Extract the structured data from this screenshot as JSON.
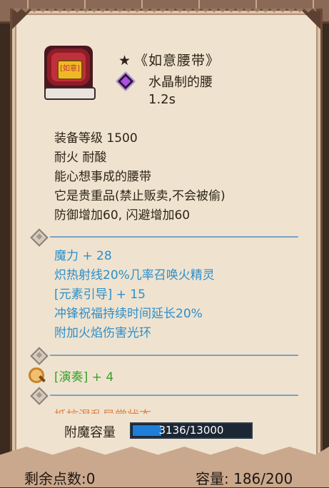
{
  "item": {
    "star": "★",
    "name": "《如意腰带》",
    "subtype": "水晶制的腰",
    "speed": "1.2s",
    "buckle_text": "[如意]",
    "gem_color": "#b14fe0"
  },
  "base_stats": [
    "装备等级 1500",
    "耐火  耐酸",
    "能心想事成的腰带",
    "它是贵重品(禁止贩卖,不会被偷)",
    "防御增加60, 闪避增加60"
  ],
  "enchant_stats": [
    "魔力 + 28",
    "炽热射线20%几率召唤火精灵",
    "[元素引导] + 15",
    "冲锋祝福持续时间延长20%",
    "附加火焰伤害光环"
  ],
  "skill_line": "[演奏] + 4",
  "faded_line": "抵抗混乱异常状态",
  "capacity": {
    "label": "附魔容量",
    "text": "3136/13000",
    "fraction": 0.241
  },
  "footer": {
    "left": "剩余点数:0",
    "right": "容量: 186/200"
  },
  "colors": {
    "base_text": "#2d2418",
    "enchant_text": "#2b8fcc",
    "skill_text": "#3aa02a",
    "capacity_fill": "#1f7ed8"
  }
}
